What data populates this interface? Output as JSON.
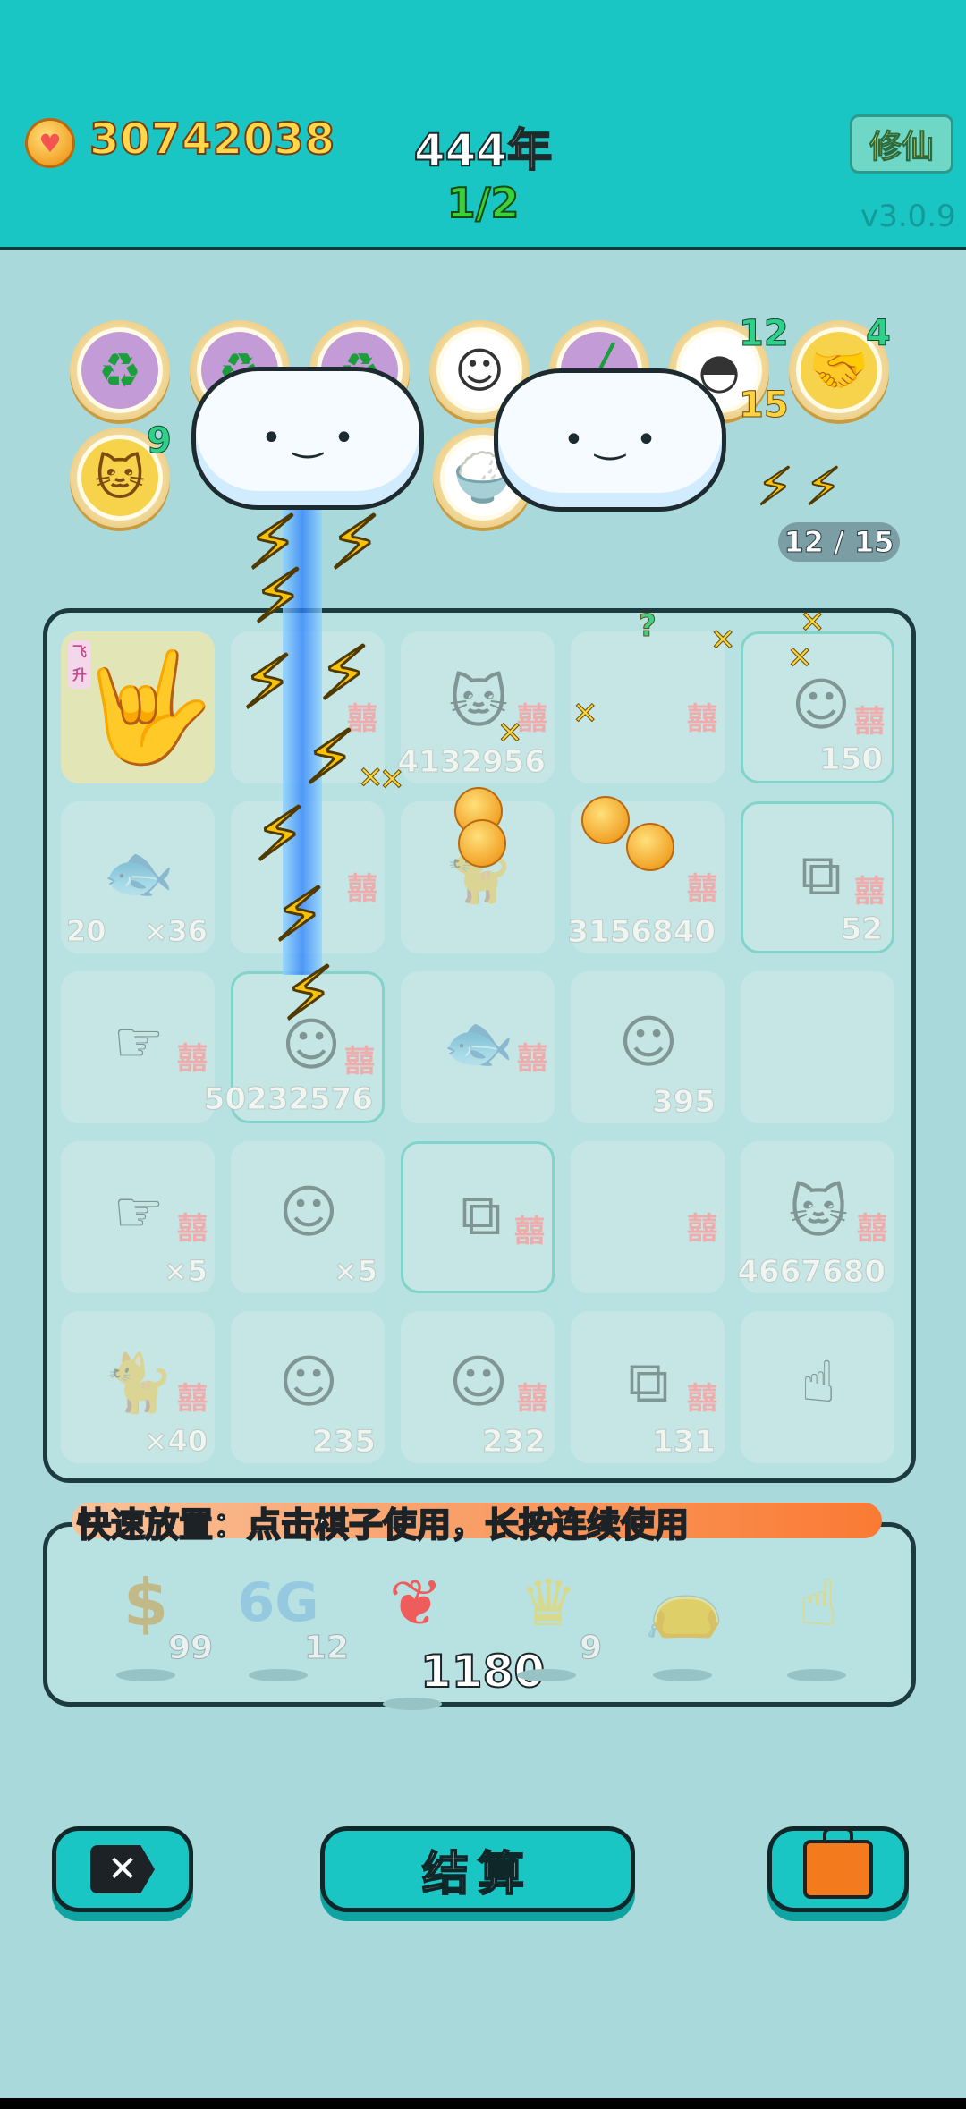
{
  "header": {
    "coins": "30742038",
    "year": "444年",
    "stage": "1/2",
    "mode_button": "修仙",
    "version": "v3.0.9"
  },
  "bubbles": {
    "shell_top": "12",
    "shell_bottom": "15",
    "handshake": "4",
    "cat": "9"
  },
  "energy": {
    "label": "12 / 15"
  },
  "board": {
    "cells": [
      {
        "tag": "飞升",
        "count": ""
      },
      {
        "tag": "",
        "count": "4132956"
      },
      {
        "tag": "",
        "count": "150"
      },
      {
        "left": "20",
        "mult": "×36"
      },
      {
        "count": "3156840"
      },
      {
        "count": "52"
      },
      {
        "count": "50232576"
      },
      {
        "count": "395"
      },
      {
        "mult": "×5"
      },
      {
        "mult2": "×5"
      },
      {
        "count": "4667680"
      },
      {
        "mult": "×40"
      },
      {
        "count": "235"
      },
      {
        "count": "232"
      },
      {
        "count": "131"
      }
    ]
  },
  "quick": {
    "text": "快速放置：点击棋子使用，长按连续使用"
  },
  "tray": {
    "coin_count": "99",
    "g6_label": "6G",
    "g6_count": "12",
    "liver_count": "1180",
    "crown_count": "9"
  },
  "buttons": {
    "settle": "结算"
  }
}
